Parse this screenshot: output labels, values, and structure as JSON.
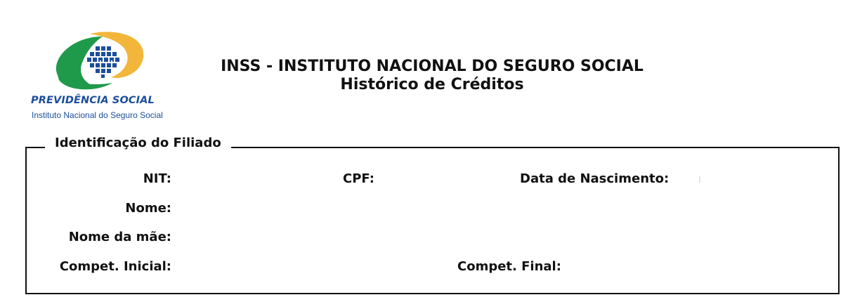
{
  "logo": {
    "brand": "PREVIDÊNCIA SOCIAL",
    "subtitle": "Instituto Nacional do Seguro Social",
    "colors": {
      "green": "#1f9a4a",
      "yellow": "#f2b63a",
      "blue": "#1b4e9b"
    }
  },
  "header": {
    "title": "INSS - INSTITUTO NACIONAL DO SEGURO SOCIAL",
    "subtitle": "Histórico de Créditos"
  },
  "section": {
    "legend": "Identificação do Filiado",
    "fields": {
      "nit": "NIT:",
      "cpf": "CPF:",
      "data_nascimento": "Data de Nascimento:",
      "nome": "Nome:",
      "nome_mae": "Nome da mãe:",
      "compet_inicial": "Compet. Inicial:",
      "compet_final": "Compet. Final:"
    }
  }
}
